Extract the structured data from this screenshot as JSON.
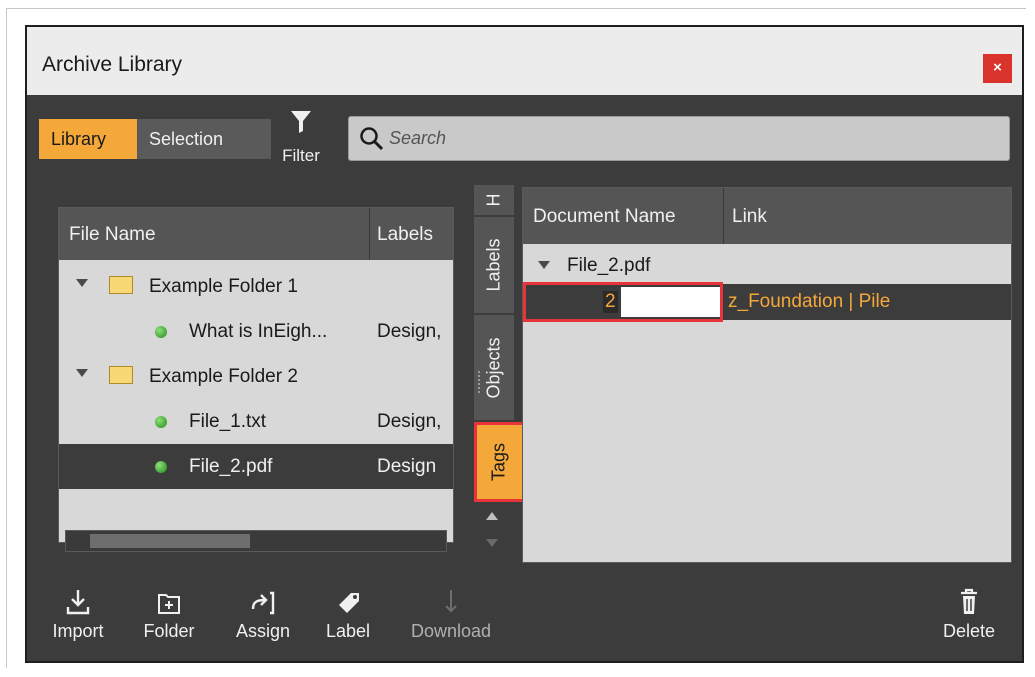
{
  "window": {
    "title": "Archive Library",
    "close_label": "×"
  },
  "tabs": {
    "library": "Library",
    "selection": "Selection"
  },
  "filter": {
    "label": "Filter"
  },
  "search": {
    "placeholder": "Search"
  },
  "file_table": {
    "headers": {
      "file_name": "File Name",
      "labels": "Labels"
    },
    "rows": [
      {
        "name": "Example Folder 1",
        "labels": ""
      },
      {
        "name": "What is InEigh...",
        "labels": "Design,"
      },
      {
        "name": "Example Folder 2",
        "labels": ""
      },
      {
        "name": "File_1.txt",
        "labels": "Design,"
      },
      {
        "name": "File_2.pdf",
        "labels": "Design"
      }
    ]
  },
  "side_tabs": {
    "top_partial": "H",
    "labels": "Labels",
    "objects": "Objects",
    "tags": "Tags"
  },
  "doc_table": {
    "headers": {
      "document_name": "Document Name",
      "link": "Link"
    },
    "group": "File_2.pdf",
    "row": {
      "value": "2",
      "link": "z_Foundation | Pile"
    }
  },
  "toolbar": {
    "import": "Import",
    "folder": "Folder",
    "assign": "Assign",
    "label": "Label",
    "download": "Download",
    "delete": "Delete"
  },
  "colors": {
    "accent": "#f4a83a",
    "highlight": "#e8333a",
    "panel": "#3c3c3c"
  }
}
